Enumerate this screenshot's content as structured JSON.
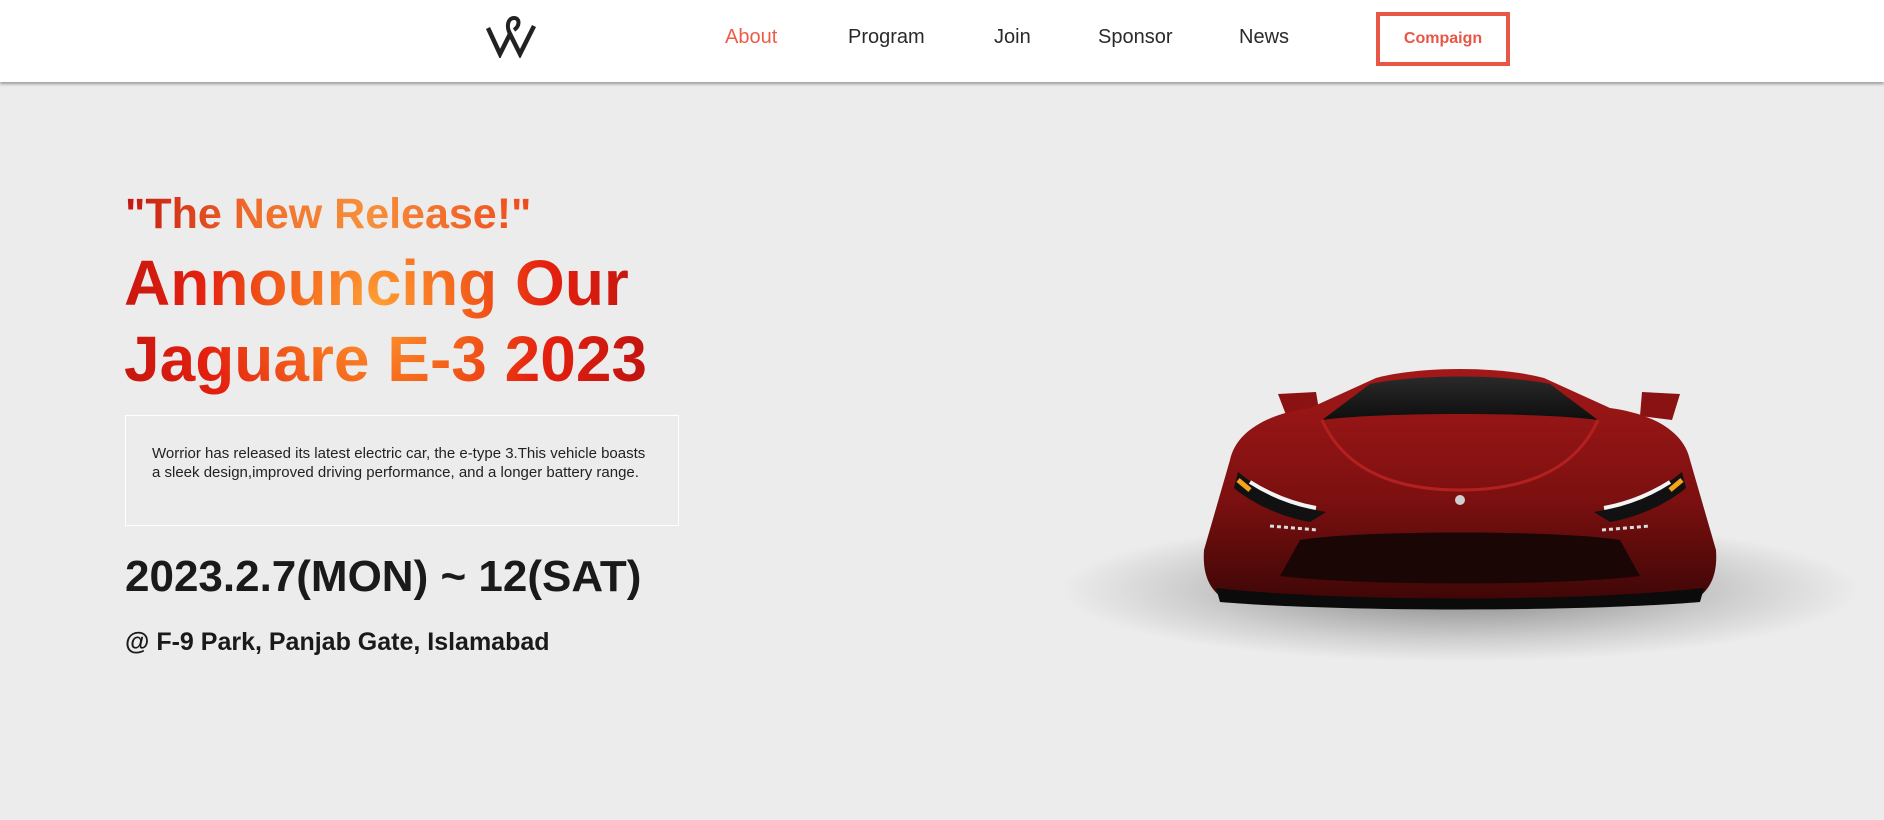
{
  "nav": {
    "items": [
      {
        "label": "About",
        "active": true
      },
      {
        "label": "Program",
        "active": false
      },
      {
        "label": "Join",
        "active": false
      },
      {
        "label": "Sponsor",
        "active": false
      },
      {
        "label": "News",
        "active": false
      }
    ],
    "cta_label": "Compaign"
  },
  "hero": {
    "tagline": "\"The New Release!\"",
    "title": "Announcing Our Jaguare E-3 2023",
    "description": "Worrior has released its latest electric car, the e-type 3.This vehicle boasts a sleek design,improved driving performance, and a longer battery range.",
    "date": "2023.2.7(MON) ~ 12(SAT)",
    "location": "@ F-9 Park, Panjab Gate, Islamabad"
  },
  "colors": {
    "accent": "#ef5b47",
    "cta_border": "#e85646",
    "background": "#ececec",
    "car_body": "#8e1414"
  },
  "icons": {
    "logo": "w-logo-icon"
  }
}
